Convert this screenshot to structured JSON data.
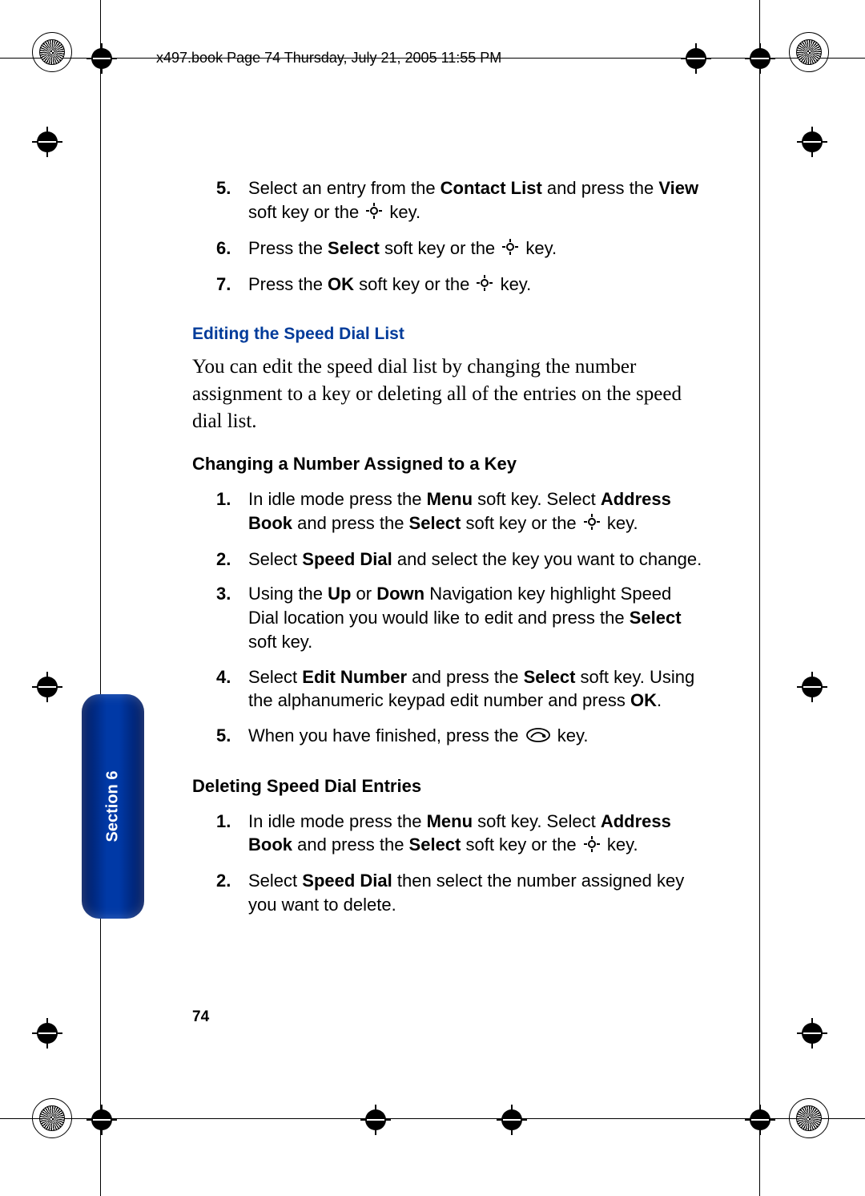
{
  "header": {
    "running": "x497.book  Page 74  Thursday, July 21, 2005  11:55 PM"
  },
  "page_number": "74",
  "section_tab": "Section 6",
  "icons": {
    "nav": "nav-key-icon",
    "end": "end-key-icon"
  },
  "lists": {
    "first": [
      {
        "n": "5.",
        "pre": "Select an entry from the ",
        "b1": "Contact List",
        "mid": " and press the ",
        "b2": "View",
        "post": " soft key or the ",
        "tail": " key."
      },
      {
        "n": "6.",
        "pre": "Press the ",
        "b1": "Select",
        "mid": " soft key or the ",
        "tail": " key."
      },
      {
        "n": "7.",
        "pre": "Press the ",
        "b1": "OK",
        "mid": " soft key or the ",
        "tail": " key."
      }
    ],
    "change": [
      {
        "n": "1.",
        "text_a": "In idle mode press the ",
        "b1": "Menu",
        "text_b": " soft key. Select ",
        "b2": "Address Book",
        "text_c": " and press the ",
        "b3": "Select",
        "text_d": " soft key or the ",
        "tail": " key."
      },
      {
        "n": "2.",
        "text_a": "Select ",
        "b1": "Speed Dial",
        "text_b": " and select the key you want to change."
      },
      {
        "n": "3.",
        "text_a": "Using the ",
        "b1": "Up",
        "text_b": " or ",
        "b2": "Down",
        "text_c": " Navigation key highlight Speed Dial location you would like to edit and press the ",
        "b3": "Select",
        "text_d": " soft key."
      },
      {
        "n": "4.",
        "text_a": "Select ",
        "b1": "Edit Number",
        "text_b": " and press the ",
        "b2": "Select",
        "text_c": " soft key. Using the alphanumeric keypad edit number and press ",
        "b3": "OK",
        "text_d": "."
      },
      {
        "n": "5.",
        "text_a": "When you have finished, press the ",
        "tail": " key.",
        "end_icon": true
      }
    ],
    "delete": [
      {
        "n": "1.",
        "text_a": "In idle mode press the ",
        "b1": "Menu",
        "text_b": " soft key. Select ",
        "b2": "Address Book",
        "text_c": " and press the ",
        "b3": "Select",
        "text_d": " soft key or the ",
        "tail": " key."
      },
      {
        "n": "2.",
        "text_a": "Select ",
        "b1": "Speed Dial",
        "text_b": " then select the number assigned key you want to delete."
      }
    ]
  },
  "headings": {
    "edit_blue": "Editing the Speed Dial List",
    "intro": "You can edit the speed dial list by changing the number assignment to a key or deleting all of the entries on the speed dial list.",
    "change": "Changing a Number Assigned to a Key",
    "delete": "Deleting Speed Dial Entries"
  }
}
